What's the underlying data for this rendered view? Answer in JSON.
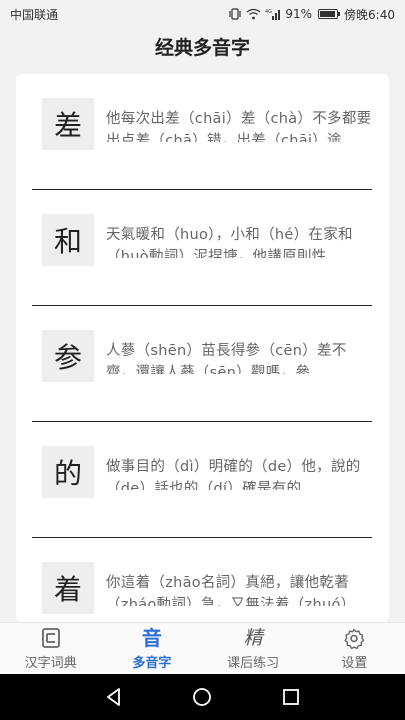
{
  "status_bar": {
    "carrier": "中国联通",
    "battery": "91%",
    "time": "傍晚6:40"
  },
  "header": {
    "title": "经典多音字"
  },
  "items": [
    {
      "char": "差",
      "example": "他每次出差（chāi）差（chà）不多都要出点差（chā）错，出差（chāi）途"
    },
    {
      "char": "和",
      "example": "天氣暖和（huo），小和（hé）在家和（huò動詞）泥捏塘，他講原則性"
    },
    {
      "char": "参",
      "example": "人蔘（shēn）苗長得參（cēn）差不齊，還讓人蔘（sēn）觀嗎，參"
    },
    {
      "char": "的",
      "example": "做事目的（dì）明確的（de）他，說的（de）話也的（dí）確是有的"
    },
    {
      "char": "着",
      "example": "你這着（zhāo名詞）真絕，讓他乾著（zháo動詞）急，又無法着（zhuó）"
    }
  ],
  "tabs": [
    {
      "label": "汉字词典",
      "icon": "dictionary-icon"
    },
    {
      "label": "多音字",
      "icon": "polyphone-icon"
    },
    {
      "label": "课后练习",
      "icon": "practice-icon"
    },
    {
      "label": "设置",
      "icon": "gear-icon"
    }
  ],
  "active_tab": "多音字",
  "colors": {
    "accent": "#2a6fd6",
    "divider": "#222222",
    "char_bg": "#eeeeee"
  }
}
